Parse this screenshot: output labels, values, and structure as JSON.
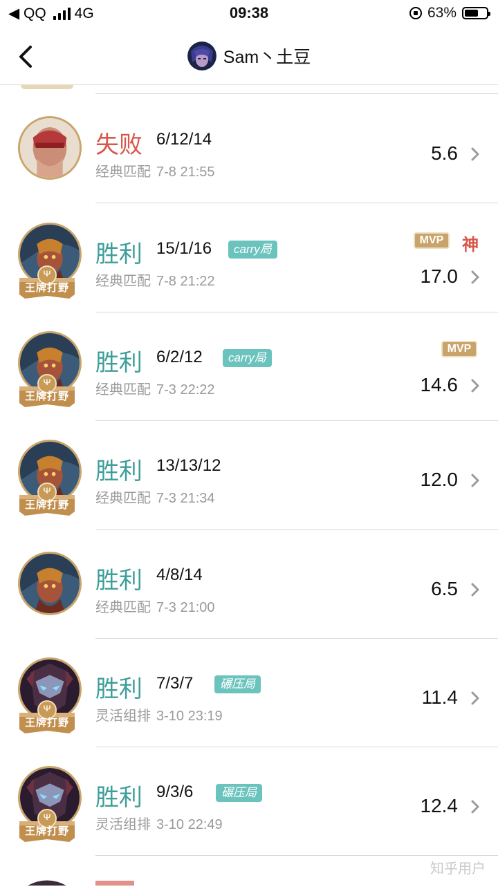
{
  "status_bar": {
    "back_app": "◀ QQ",
    "network": "4G",
    "time": "09:38",
    "battery": "63%",
    "battery_level": 0.63
  },
  "nav": {
    "title": "Sam丶土豆",
    "back_icon": "chevron-left-icon"
  },
  "colors": {
    "win": "#3d9e9a",
    "loss": "#d9564a",
    "tag_bg": "#6bc3be",
    "gold": "#c8a36a"
  },
  "matches": [
    {
      "result": "失败",
      "type": "loss",
      "kda": "6/12/14",
      "mode": "经典匹配",
      "time": "7-8 21:55",
      "score": "5.6",
      "badge": "",
      "tag": "",
      "mvp": "",
      "god": "",
      "hero": "lee-sin"
    },
    {
      "result": "胜利",
      "type": "win",
      "kda": "15/1/16",
      "mode": "经典匹配",
      "time": "7-8 21:22",
      "score": "17.0",
      "badge": "王牌打野",
      "tag": "carry局",
      "mvp": "MVP",
      "god": "神",
      "hero": "jungler-a"
    },
    {
      "result": "胜利",
      "type": "win",
      "kda": "6/2/12",
      "mode": "经典匹配",
      "time": "7-3 22:22",
      "score": "14.6",
      "badge": "王牌打野",
      "tag": "carry局",
      "mvp": "MVP",
      "god": "",
      "hero": "jungler-a"
    },
    {
      "result": "胜利",
      "type": "win",
      "kda": "13/13/12",
      "mode": "经典匹配",
      "time": "7-3 21:34",
      "score": "12.0",
      "badge": "王牌打野",
      "tag": "",
      "mvp": "",
      "god": "",
      "hero": "jungler-a"
    },
    {
      "result": "胜利",
      "type": "win",
      "kda": "4/8/14",
      "mode": "经典匹配",
      "time": "7-3 21:00",
      "score": "6.5",
      "badge": "",
      "tag": "",
      "mvp": "",
      "god": "",
      "hero": "jungler-a"
    },
    {
      "result": "胜利",
      "type": "win",
      "kda": "7/3/7",
      "mode": "灵活组排",
      "time": "3-10 23:19",
      "score": "11.4",
      "badge": "王牌打野",
      "tag": "碾压局",
      "mvp": "",
      "god": "",
      "hero": "jungler-b"
    },
    {
      "result": "胜利",
      "type": "win",
      "kda": "9/3/6",
      "mode": "灵活组排",
      "time": "3-10 22:49",
      "score": "12.4",
      "badge": "王牌打野",
      "tag": "碾压局",
      "mvp": "",
      "god": "",
      "hero": "jungler-b"
    }
  ],
  "watermark": "知乎用户"
}
